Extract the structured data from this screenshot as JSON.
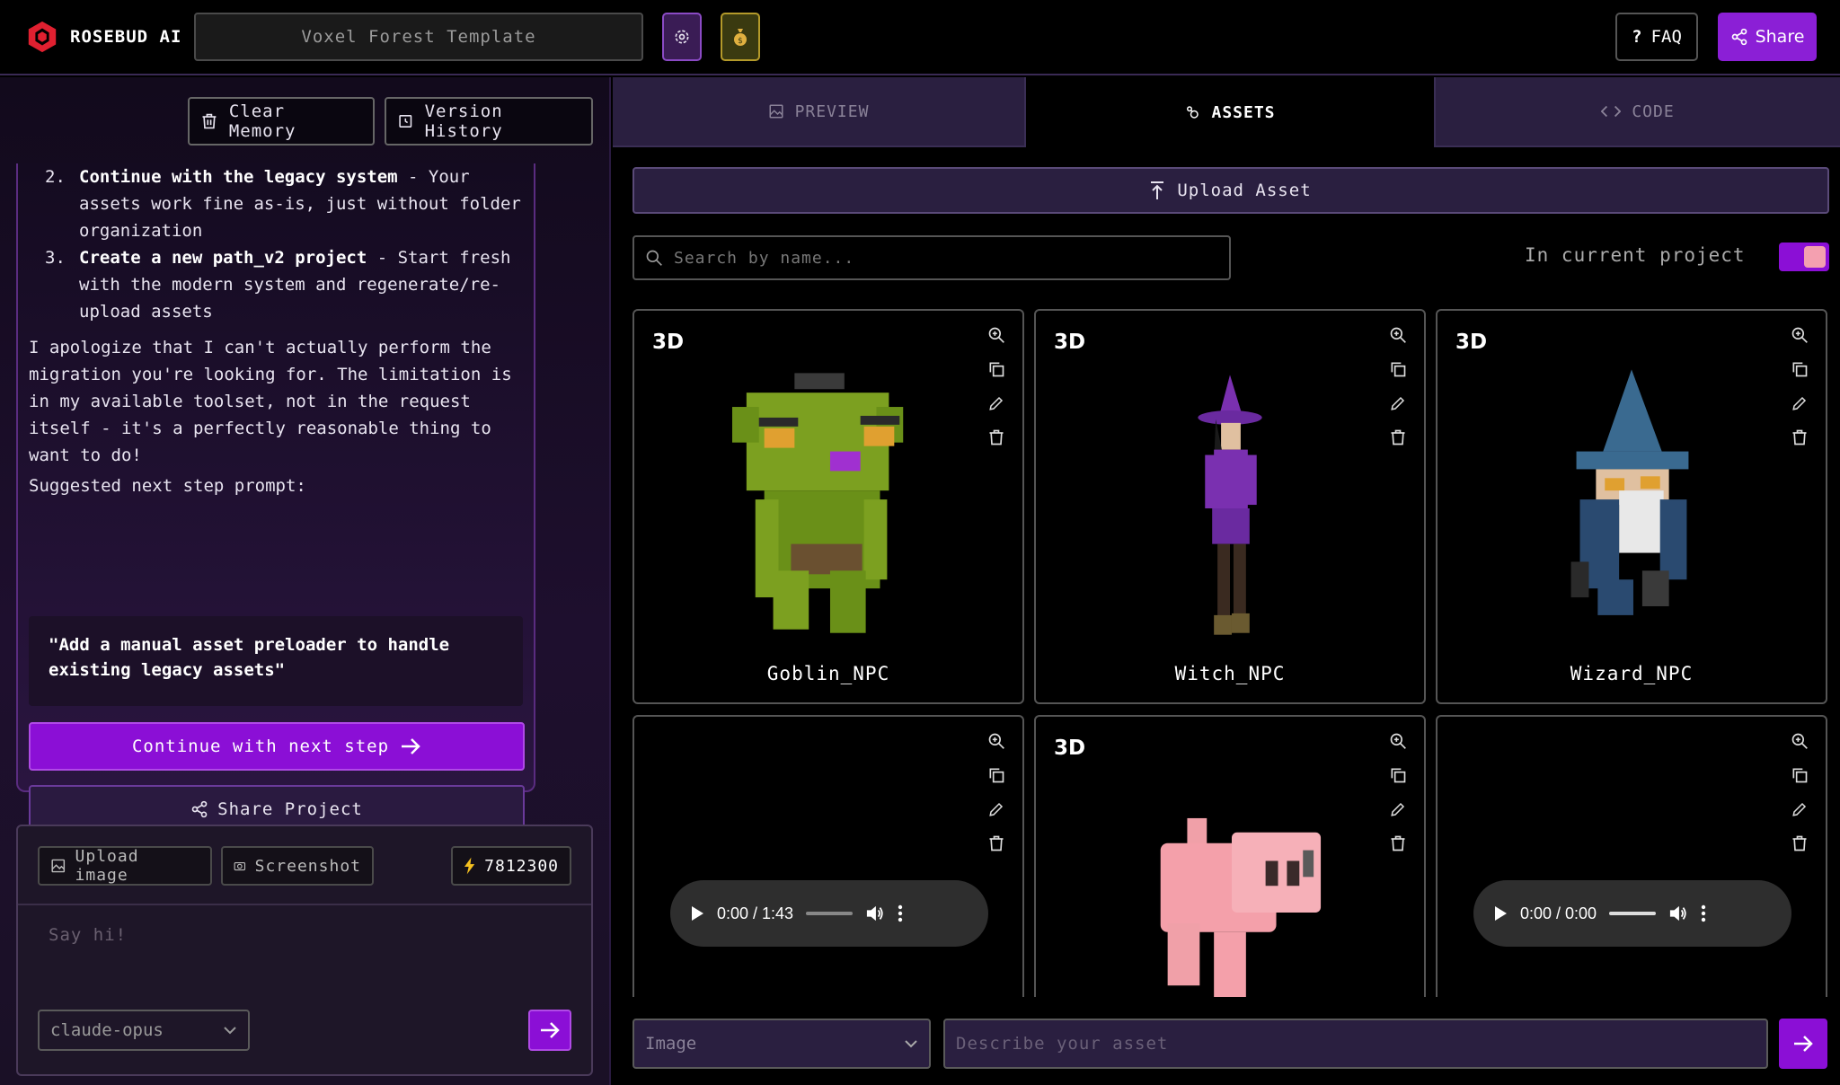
{
  "app": {
    "brand": "ROSEBUD AI",
    "project_title": "Voxel Forest Template",
    "faq_label": "FAQ",
    "share_label": "Share"
  },
  "left": {
    "clear_memory": "Clear Memory",
    "version_history": "Version History",
    "chat": {
      "item2_num": "2.",
      "item2_bold": "Continue with the legacy system",
      "item2_rest": " - Your assets work fine as-is, just without folder organization",
      "item3_num": "3.",
      "item3_bold": "Create a new path_v2 project",
      "item3_rest": " - Start fresh with the modern system and regenerate/re-upload assets",
      "apology": "I apologize that I can't actually perform the migration you're looking for. The limitation is in my available toolset, not in the request itself - it's a perfectly reasonable thing to want to do!",
      "suggested": "Suggested next step prompt:",
      "quote": "\"Add a manual asset preloader to handle existing legacy assets\"",
      "continue_btn": "Continue with next step",
      "share_project": "Share Project"
    },
    "composer": {
      "upload_image": "Upload image",
      "screenshot": "Screenshot",
      "tokens": "7812300",
      "placeholder": "Say hi!",
      "model": "claude-opus"
    }
  },
  "tabs": {
    "preview": "PREVIEW",
    "assets": "ASSETS",
    "code": "CODE"
  },
  "assets": {
    "upload_asset": "Upload Asset",
    "search_placeholder": "Search by name...",
    "in_current_project": "In current project",
    "in_current_project_on": true,
    "cards": [
      {
        "badge": "3D",
        "name": "Goblin_NPC"
      },
      {
        "badge": "3D",
        "name": "Witch_NPC"
      },
      {
        "badge": "3D",
        "name": "Wizard_NPC"
      },
      {
        "badge": "",
        "name": "",
        "audio_time": "0:00 / 1:43"
      },
      {
        "badge": "3D",
        "name": ""
      },
      {
        "badge": "",
        "name": "",
        "audio_time": "0:00 / 0:00"
      }
    ],
    "type_select": "Image",
    "describe_placeholder": "Describe your asset"
  },
  "colors": {
    "accent": "#8b0fd6",
    "panel": "#2a1f40",
    "border": "#555555"
  },
  "icons": {
    "brand": "rosebud-logo-icon",
    "settings": "gear-icon",
    "credits": "money-bag-icon",
    "faq": "question-icon",
    "share": "share-icon"
  }
}
